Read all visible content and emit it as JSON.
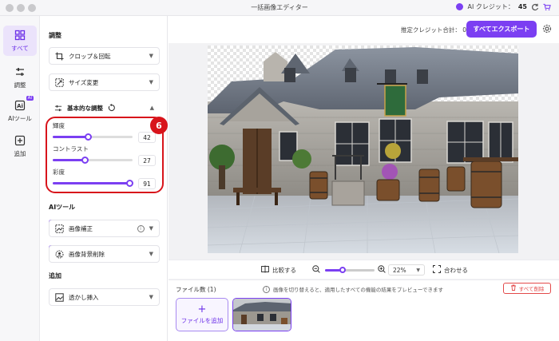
{
  "window": {
    "title": "一括画像エディター"
  },
  "credits": {
    "label": "AI クレジット：",
    "value": "45"
  },
  "rail": {
    "items": [
      {
        "label": "すべて",
        "icon": "grid-icon"
      },
      {
        "label": "調整",
        "icon": "sliders-icon"
      },
      {
        "label": "AIツール",
        "icon": "ai-tool-icon",
        "badge": "AI"
      },
      {
        "label": "追加",
        "icon": "plus-square-icon"
      }
    ]
  },
  "panel": {
    "adjust_title": "調整",
    "crop_label": "クロップ＆回転",
    "resize_label": "サイズ変更",
    "basic_label": "基本的な調整",
    "sliders": [
      {
        "label": "輝度",
        "value": "42",
        "fraction": 0.44
      },
      {
        "label": "コントラスト",
        "value": "27",
        "fraction": 0.4
      },
      {
        "label": "彩度",
        "value": "91",
        "fraction": 0.96
      }
    ],
    "step_badge": "6",
    "ai_title": "AIツール",
    "enhance_label": "画像補正",
    "bgremove_label": "画像背景削除",
    "add_title": "追加",
    "watermark_label": "透かし挿入"
  },
  "topbar": {
    "estimate_label": "推定クレジット合計： 0",
    "export_label": "すべてエクスポート"
  },
  "zoombar": {
    "compare_label": "比較する",
    "zoom_value": "22%",
    "zoom_fraction": 0.36,
    "fit_label": "合わせる"
  },
  "files": {
    "count_label": "ファイル数 (1)",
    "hint": "画像を切り替えると、適用したすべての機能の結果をプレビューできます",
    "delete_all_label": "すべて削除",
    "add_label": "ファイルを追加",
    "add_plus": "+"
  },
  "colors": {
    "accent": "#7b3ff2",
    "highlight": "#d8141b"
  }
}
